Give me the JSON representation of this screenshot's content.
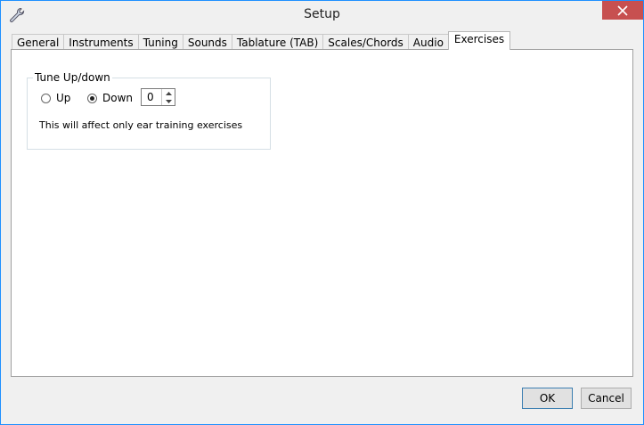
{
  "window": {
    "title": "Setup"
  },
  "tabs": [
    {
      "label": "General"
    },
    {
      "label": "Instruments"
    },
    {
      "label": "Tuning"
    },
    {
      "label": "Sounds"
    },
    {
      "label": "Tablature (TAB)"
    },
    {
      "label": "Scales/Chords"
    },
    {
      "label": "Audio"
    },
    {
      "label": "Exercises"
    }
  ],
  "active_tab": "Exercises",
  "tune_group": {
    "title": "Tune Up/down",
    "up_label": "Up",
    "down_label": "Down",
    "selected": "Down",
    "value": "0",
    "note": "This will affect only ear training exercises"
  },
  "buttons": {
    "ok": "OK",
    "cancel": "Cancel"
  },
  "colors": {
    "close_button": "#c75050",
    "accent_border": "#1e90ff"
  },
  "icons": {
    "app": "wrench-icon",
    "close": "close-icon"
  }
}
